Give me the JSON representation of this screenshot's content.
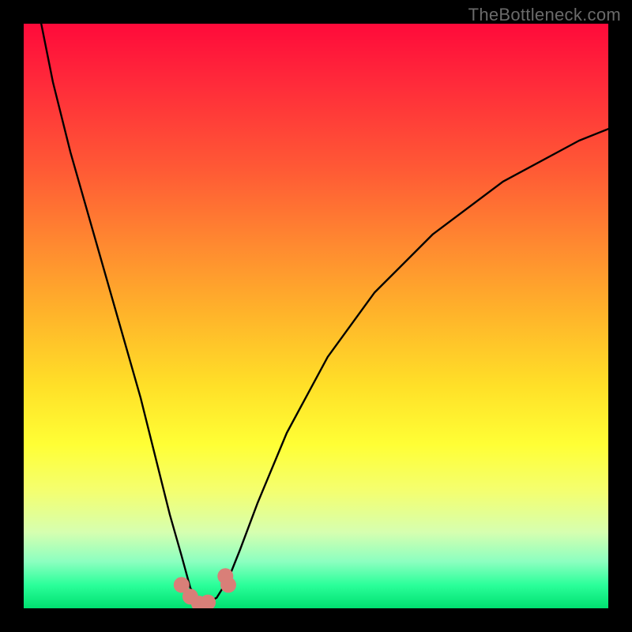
{
  "watermark": "TheBottleneck.com",
  "chart_data": {
    "type": "line",
    "title": "",
    "xlabel": "",
    "ylabel": "",
    "xlim": [
      0,
      100
    ],
    "ylim": [
      0,
      100
    ],
    "series": [
      {
        "name": "bottleneck-curve",
        "x": [
          3,
          5,
          8,
          12,
          16,
          20,
          23,
          25,
          27,
          28.5,
          30,
          31.5,
          33,
          35,
          37,
          40,
          45,
          52,
          60,
          70,
          82,
          95,
          100
        ],
        "values": [
          100,
          90,
          78,
          64,
          50,
          36,
          24,
          16,
          9,
          3.5,
          1.2,
          1.0,
          1.8,
          5,
          10,
          18,
          30,
          43,
          54,
          64,
          73,
          80,
          82
        ]
      }
    ],
    "markers": [
      {
        "name": "left-caliper-bottom",
        "x": 27.0,
        "y": 4.0
      },
      {
        "name": "left-caliper-mid",
        "x": 28.5,
        "y": 2.0
      },
      {
        "name": "notch-bottom",
        "x": 30.0,
        "y": 0.8
      },
      {
        "name": "notch-right",
        "x": 31.5,
        "y": 1.0
      },
      {
        "name": "right-caliper-top",
        "x": 34.5,
        "y": 5.5
      },
      {
        "name": "right-caliper-bottom",
        "x": 35.0,
        "y": 4.0
      }
    ],
    "marker_color": "#d97f78",
    "marker_radius": 10
  }
}
